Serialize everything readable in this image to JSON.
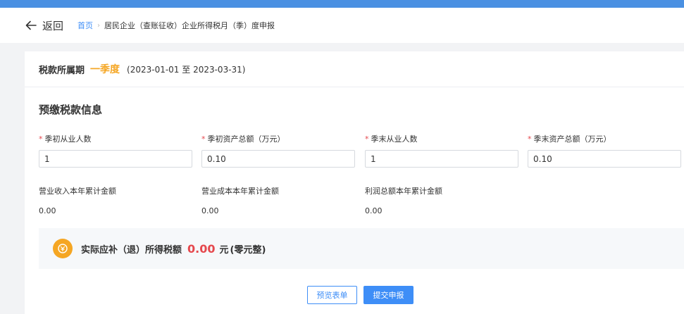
{
  "nav": {
    "back_label": "返回",
    "breadcrumb": {
      "home": "首页",
      "separator": "›",
      "current": "居民企业（查账征收）企业所得税月（季）度申报"
    }
  },
  "period": {
    "label": "税款所属期",
    "value": "一季度",
    "range": "(2023-01-01 至 2023-03-31)"
  },
  "section_title": "预缴税款信息",
  "fields": [
    {
      "label": "季初从业人数",
      "value": "1",
      "required": true
    },
    {
      "label": "季初资产总额（万元）",
      "value": "0.10",
      "required": true
    },
    {
      "label": "季末从业人数",
      "value": "1",
      "required": true
    },
    {
      "label": "季末资产总额（万元）",
      "value": "0.10",
      "required": true
    }
  ],
  "stats": [
    {
      "label": "营业收入本年累计金额",
      "value": "0.00"
    },
    {
      "label": "营业成本本年累计金额",
      "value": "0.00"
    },
    {
      "label": "利润总额本年累计金额",
      "value": "0.00"
    }
  ],
  "tax": {
    "icon": "coin-icon",
    "label": "实际应补（退）所得税额",
    "amount": "0.00",
    "unit": "元",
    "in_words": "(零元整)"
  },
  "buttons": {
    "preview": "预览表单",
    "submit": "提交申报"
  },
  "colors": {
    "primary": "#3e8ef7",
    "accent": "#f5a623",
    "danger": "#e5484d",
    "topbar": "#4a90e2"
  }
}
